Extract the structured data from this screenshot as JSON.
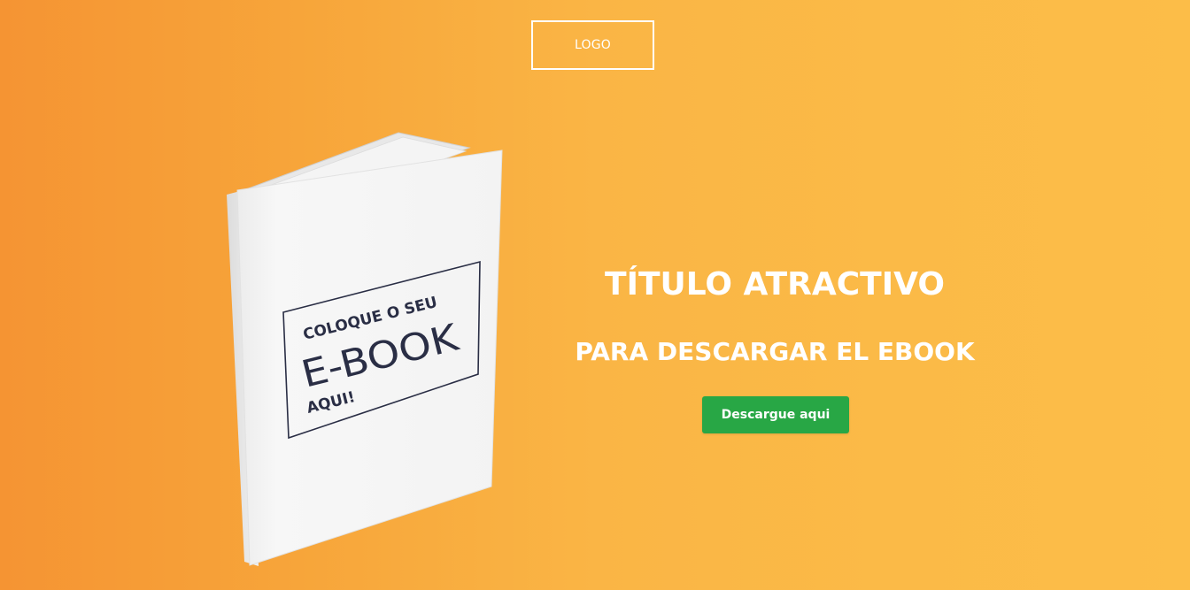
{
  "header": {
    "logo_label": "LOGO"
  },
  "book": {
    "cover_line1": "COLOQUE O SEU",
    "cover_line2": "E-BOOK",
    "cover_line3": "AQUI!"
  },
  "hero": {
    "title": "TÍTULO ATRACTIVO",
    "subtitle": "PARA DESCARGAR EL EBOOK",
    "cta_label": "Descargue aqui"
  },
  "colors": {
    "background_left": "#f59433",
    "background_right": "#fcbd48",
    "button": "#28a745",
    "text": "#ffffff",
    "cover_ink": "#2a2e45"
  }
}
